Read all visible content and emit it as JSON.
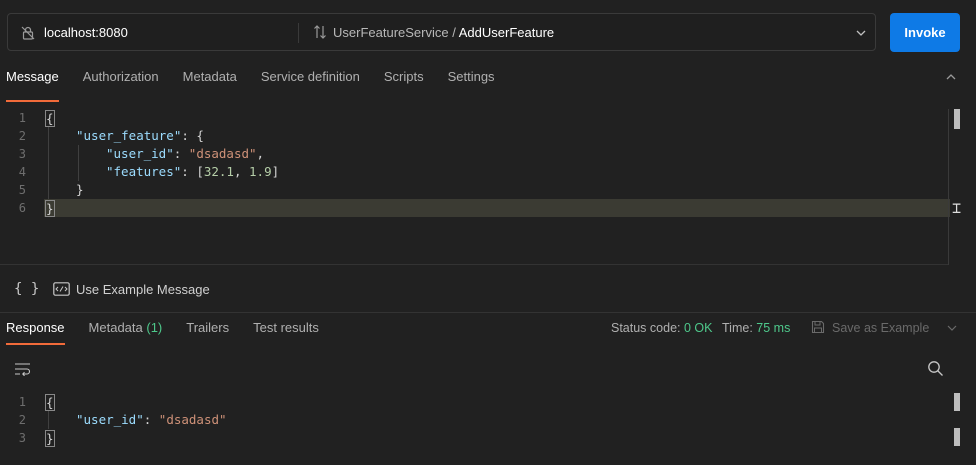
{
  "request_bar": {
    "url": "localhost:8080",
    "service": "UserFeatureService",
    "separator": "/",
    "method": "AddUserFeature",
    "invoke_label": "Invoke"
  },
  "request_tabs": [
    "Message",
    "Authorization",
    "Metadata",
    "Service definition",
    "Scripts",
    "Settings"
  ],
  "editor": {
    "line_numbers": [
      "1",
      "2",
      "3",
      "4",
      "5",
      "6"
    ],
    "l1": "{",
    "l2_key": "\"user_feature\"",
    "l2_rest": ": {",
    "l3_key": "\"user_id\"",
    "l3_colon": ": ",
    "l3_val": "\"dsadasd\"",
    "l3_comma": ",",
    "l4_key": "\"features\"",
    "l4_open": ": [",
    "l4_n1": "32.1",
    "l4_sep": ", ",
    "l4_n2": "1.9",
    "l4_close": "]",
    "l5": "}",
    "l6": "}"
  },
  "message_toolbar": {
    "format_icon": "{ }",
    "use_example_label": "Use Example Message"
  },
  "response_tabs": {
    "response": "Response",
    "metadata": "Metadata",
    "metadata_count": "(1)",
    "trailers": "Trailers",
    "test_results": "Test results"
  },
  "response_status": {
    "status_label": "Status code:",
    "status_value": "0 OK",
    "time_label": "Time:",
    "time_value": "75 ms",
    "save_label": "Save as Example"
  },
  "response_body": {
    "line_numbers": [
      "1",
      "2",
      "3"
    ],
    "l1": "{",
    "l2_key": "\"user_id\"",
    "l2_colon": ": ",
    "l2_val": "\"dsadasd\"",
    "l3": "}"
  },
  "colors": {
    "accent": "#f26b3a",
    "invoke": "#0e7ae6",
    "ok": "#4ec88b"
  }
}
